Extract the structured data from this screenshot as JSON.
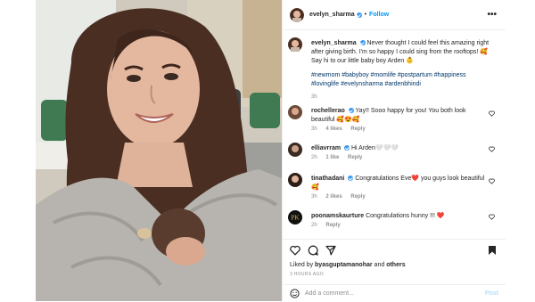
{
  "post": {
    "username": "evelyn_sharma",
    "follow_label": "Follow",
    "more_label": "•••",
    "caption_text": "Never thought I could feel this amazing right after giving birth. I'm so happy I could sing from the rooftops! 🥰 Say hi to our little baby boy Arden 👶",
    "hashtags": "#newmom #babyboy #momlife #postpartum #happiness #lovinglife #evelynsharma #ardenbhindi",
    "caption_age": "3h"
  },
  "comments": [
    {
      "username": "rochellerao",
      "text": "Yay!! Sooo happy for you! You both look beautiful 🥰😍🥰",
      "age": "3h",
      "likes": "4 likes",
      "reply": "Reply"
    },
    {
      "username": "elliavrram",
      "text": "Hi Arden🤍🤍🤍",
      "age": "2h",
      "likes": "1 like",
      "reply": "Reply"
    },
    {
      "username": "tinathadani",
      "text": "Congratulations Eve❤️ you guys look beautiful 🥰",
      "age": "3h",
      "likes": "2 likes",
      "reply": "Reply"
    },
    {
      "username": "poonamskaurture",
      "text": "Congratulations hunny !!! ❤️",
      "age": "2h",
      "likes": "",
      "reply": "Reply"
    }
  ],
  "likes": {
    "liked_by_prefix": "Liked by ",
    "liked_by_user": "byasguptamanohar",
    "and_label": " and ",
    "others_label": "others",
    "timestamp": "3 HOURS AGO"
  },
  "add_comment": {
    "placeholder": "Add a comment...",
    "post_label": "Post"
  },
  "colors": {
    "accent": "#0095f6",
    "verified": "#3897f0",
    "hashtag": "#00376b",
    "muted": "#8e8e8e",
    "text": "#262626"
  },
  "icons": [
    "verified-badge-icon",
    "more-options-icon",
    "heart-icon",
    "comment-icon",
    "share-icon",
    "save-bookmark-icon",
    "emoji-icon"
  ]
}
